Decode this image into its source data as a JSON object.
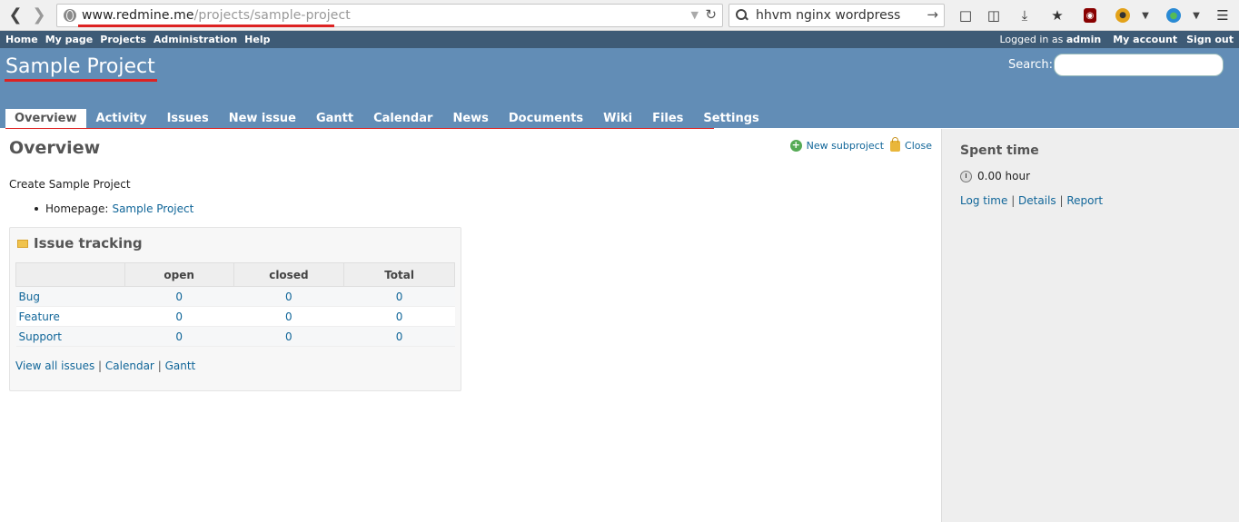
{
  "browser": {
    "url_host": "www.redmine.me",
    "url_path": "/projects/sample-project",
    "search_query": "hhvm nginx wordpress"
  },
  "topmenu": {
    "items": [
      "Home",
      "My page",
      "Projects",
      "Administration",
      "Help"
    ],
    "logged_in_prefix": "Logged in as",
    "user": "admin",
    "my_account": "My account",
    "sign_out": "Sign out"
  },
  "header": {
    "project_title": "Sample Project",
    "search_label": "Search:"
  },
  "tabs": [
    "Overview",
    "Activity",
    "Issues",
    "New issue",
    "Gantt",
    "Calendar",
    "News",
    "Documents",
    "Wiki",
    "Files",
    "Settings"
  ],
  "main": {
    "page_title": "Overview",
    "new_subproject": "New subproject",
    "close": "Close",
    "description": "Create Sample Project",
    "homepage_label": "Homepage:",
    "homepage_link": "Sample Project"
  },
  "issue_tracking": {
    "title": "Issue tracking",
    "columns": [
      "",
      "open",
      "closed",
      "Total"
    ],
    "rows": [
      {
        "name": "Bug",
        "open": "0",
        "closed": "0",
        "total": "0"
      },
      {
        "name": "Feature",
        "open": "0",
        "closed": "0",
        "total": "0"
      },
      {
        "name": "Support",
        "open": "0",
        "closed": "0",
        "total": "0"
      }
    ],
    "links": [
      "View all issues",
      "Calendar",
      "Gantt"
    ]
  },
  "sidebar": {
    "title": "Spent time",
    "hours": "0.00 hour",
    "links": [
      "Log time",
      "Details",
      "Report"
    ]
  },
  "colors": {
    "header_bg": "#628db6",
    "topmenu_bg": "#3e5b76",
    "link": "#116699",
    "annotation_red": "#dd2222"
  }
}
